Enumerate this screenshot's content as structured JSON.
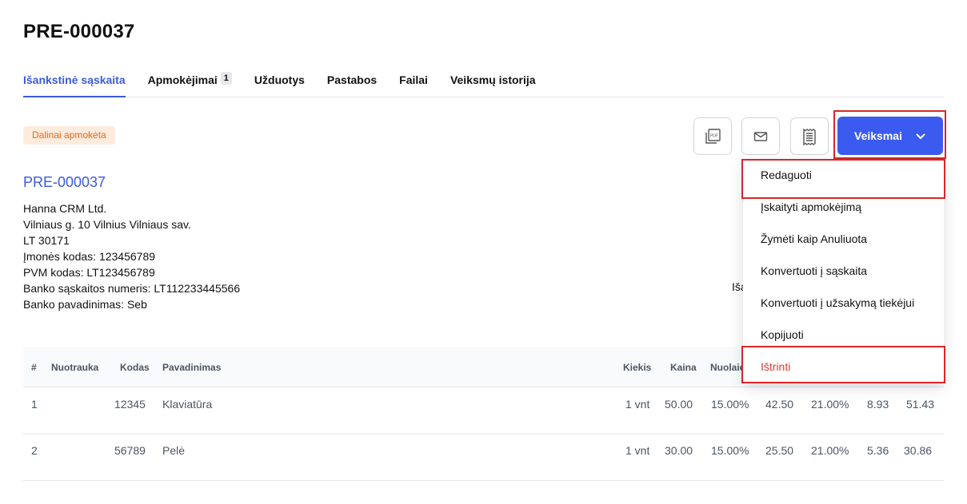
{
  "page": {
    "title": "PRE-000037"
  },
  "tabs": [
    {
      "label": "Išankstinė sąskaita",
      "active": true
    },
    {
      "label": "Apmokėjimai",
      "badge": "1"
    },
    {
      "label": "Užduotys"
    },
    {
      "label": "Pastabos"
    },
    {
      "label": "Failai"
    },
    {
      "label": "Veiksmų istorija"
    }
  ],
  "status": {
    "label": "Dalinai apmokėta",
    "bg": "#fdecdd",
    "color": "#e46a1e"
  },
  "toolbar": {
    "icons": [
      "pdf-icon",
      "mail-icon",
      "receipt-icon"
    ],
    "actions_label": "Veiksmai",
    "accent": "#3b5bf0"
  },
  "document": {
    "number": "PRE-000037",
    "company_lines": [
      "Hanna CRM Ltd.",
      "Vilniaus g. 10 Vilnius Vilniaus sav.",
      "LT 30171",
      "Įmonės kodas: 123456789",
      "PVM kodas: LT123456789",
      "Banko sąskaitos numeris: LT112233445566",
      "Banko pavadinimas: Seb"
    ],
    "right_truncated": "Iša"
  },
  "table": {
    "headers": [
      "#",
      "Nuotrauka",
      "Kodas",
      "Pavadinimas",
      "Kiekis",
      "Kaina",
      "Nuolaid"
    ],
    "rows": [
      [
        "1",
        "",
        "12345",
        "Klaviatūra",
        "1 vnt",
        "50.00",
        "15.00%",
        "42.50",
        "21.00%",
        "8.93",
        "51.43"
      ],
      [
        "2",
        "",
        "56789",
        "Pelė",
        "1 vnt",
        "30.00",
        "15.00%",
        "25.50",
        "21.00%",
        "5.36",
        "30.86"
      ]
    ]
  },
  "dropdown": {
    "items": [
      {
        "label": "Redaguoti"
      },
      {
        "label": "Įskaityti apmokėjimą"
      },
      {
        "label": "Žymėti kaip Anuliuota"
      },
      {
        "label": "Konvertuoti į sąskaita"
      },
      {
        "label": "Konvertuoti į užsakymą tiekėjui"
      },
      {
        "label": "Kopijuoti"
      },
      {
        "label": "Ištrinti",
        "danger": true
      }
    ]
  }
}
